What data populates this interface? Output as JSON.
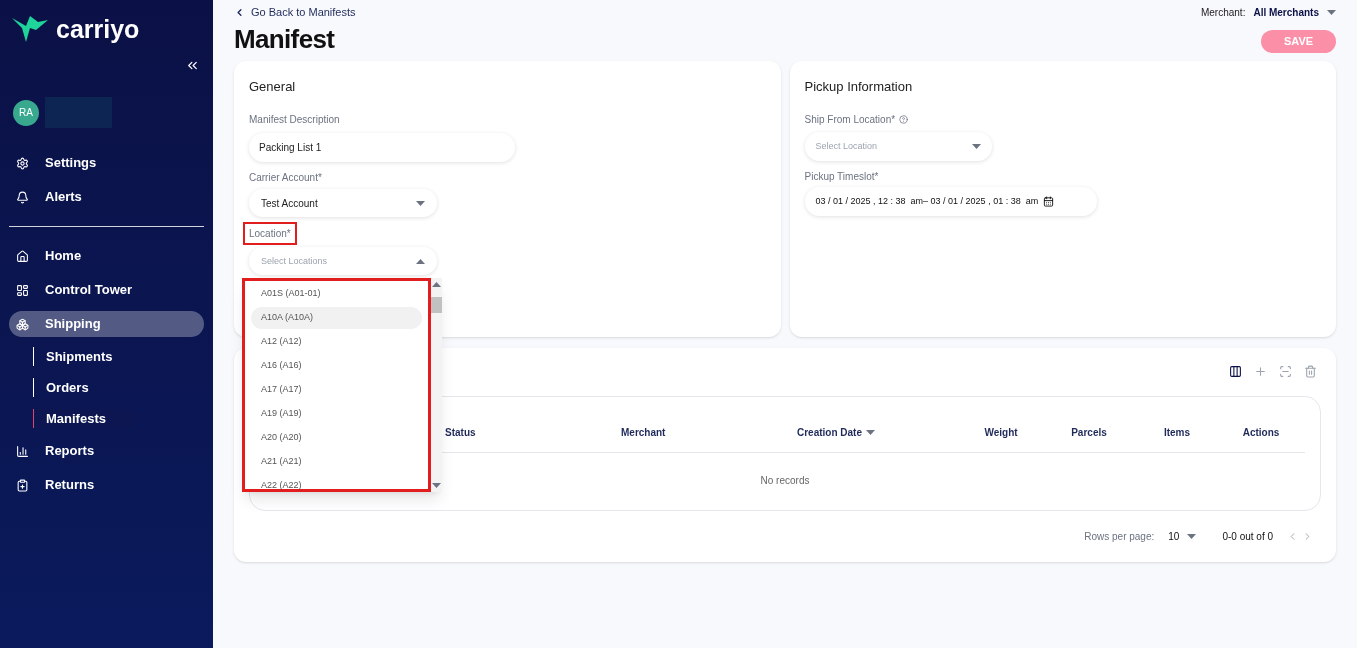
{
  "sidebar": {
    "logo_text": "carriyo",
    "avatar_initials": "RA",
    "items": [
      {
        "label": "Settings",
        "selected": false
      },
      {
        "label": "Alerts",
        "selected": false
      },
      {
        "label": "Home",
        "selected": false
      },
      {
        "label": "Control Tower",
        "selected": false
      },
      {
        "label": "Shipping",
        "selected": true,
        "children": [
          {
            "label": "Shipments",
            "selected": false
          },
          {
            "label": "Orders",
            "selected": false
          },
          {
            "label": "Manifests",
            "selected": true
          }
        ]
      },
      {
        "label": "Reports",
        "selected": false
      },
      {
        "label": "Returns",
        "selected": false
      }
    ]
  },
  "header": {
    "back_link": "Go Back to Manifests",
    "title": "Manifest",
    "merchant_label": "Merchant:",
    "merchant_value": "All Merchants",
    "save_button": "SAVE"
  },
  "general": {
    "title": "General",
    "description_label": "Manifest Description",
    "description_value": "Packing List 1",
    "carrier_label": "Carrier Account*",
    "carrier_value": "Test Account",
    "location_label": "Location*",
    "location_placeholder": "Select Locations",
    "location_options": [
      {
        "label": "A01S (A01-01)",
        "selected": false
      },
      {
        "label": "A10A (A10A)",
        "selected": true
      },
      {
        "label": "A12 (A12)",
        "selected": false
      },
      {
        "label": "A16 (A16)",
        "selected": false
      },
      {
        "label": "A17 (A17)",
        "selected": false
      },
      {
        "label": "A19 (A19)",
        "selected": false
      },
      {
        "label": "A20 (A20)",
        "selected": false
      },
      {
        "label": "A21 (A21)",
        "selected": false
      },
      {
        "label": "A22 (A22)",
        "selected": false
      }
    ]
  },
  "pickup": {
    "title": "Pickup Information",
    "ship_from_label": "Ship From Location*",
    "ship_from_placeholder": "Select Location",
    "timeslot_label": "Pickup Timeslot*",
    "timeslot_value": "03 / 01 / 2025 , 12 : 38  am– 03 / 01 / 2025 , 01 : 38  am"
  },
  "table": {
    "columns": [
      "Status",
      "Merchant",
      "Creation Date",
      "Weight",
      "Parcels",
      "Items",
      "Actions"
    ],
    "empty_text": "No records",
    "rows_per_page_label": "Rows per page:",
    "rows_per_page_value": "10",
    "range_text": "0-0 out of 0"
  }
}
